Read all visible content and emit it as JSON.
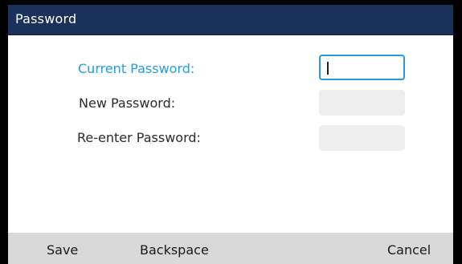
{
  "header": {
    "title": "Password"
  },
  "form": {
    "fields": [
      {
        "label": "Current Password:",
        "value": "",
        "focused": true
      },
      {
        "label": "New Password:",
        "value": "",
        "focused": false
      },
      {
        "label": "Re-enter Password:",
        "value": "",
        "focused": false
      }
    ]
  },
  "softkeys": {
    "save": "Save",
    "backspace": "Backspace",
    "cancel": "Cancel"
  },
  "colors": {
    "titlebar": "#1b3159",
    "accent": "#2a9bd6",
    "softkey_bar": "#d9d9d9",
    "field_bg": "#eeeeee"
  }
}
